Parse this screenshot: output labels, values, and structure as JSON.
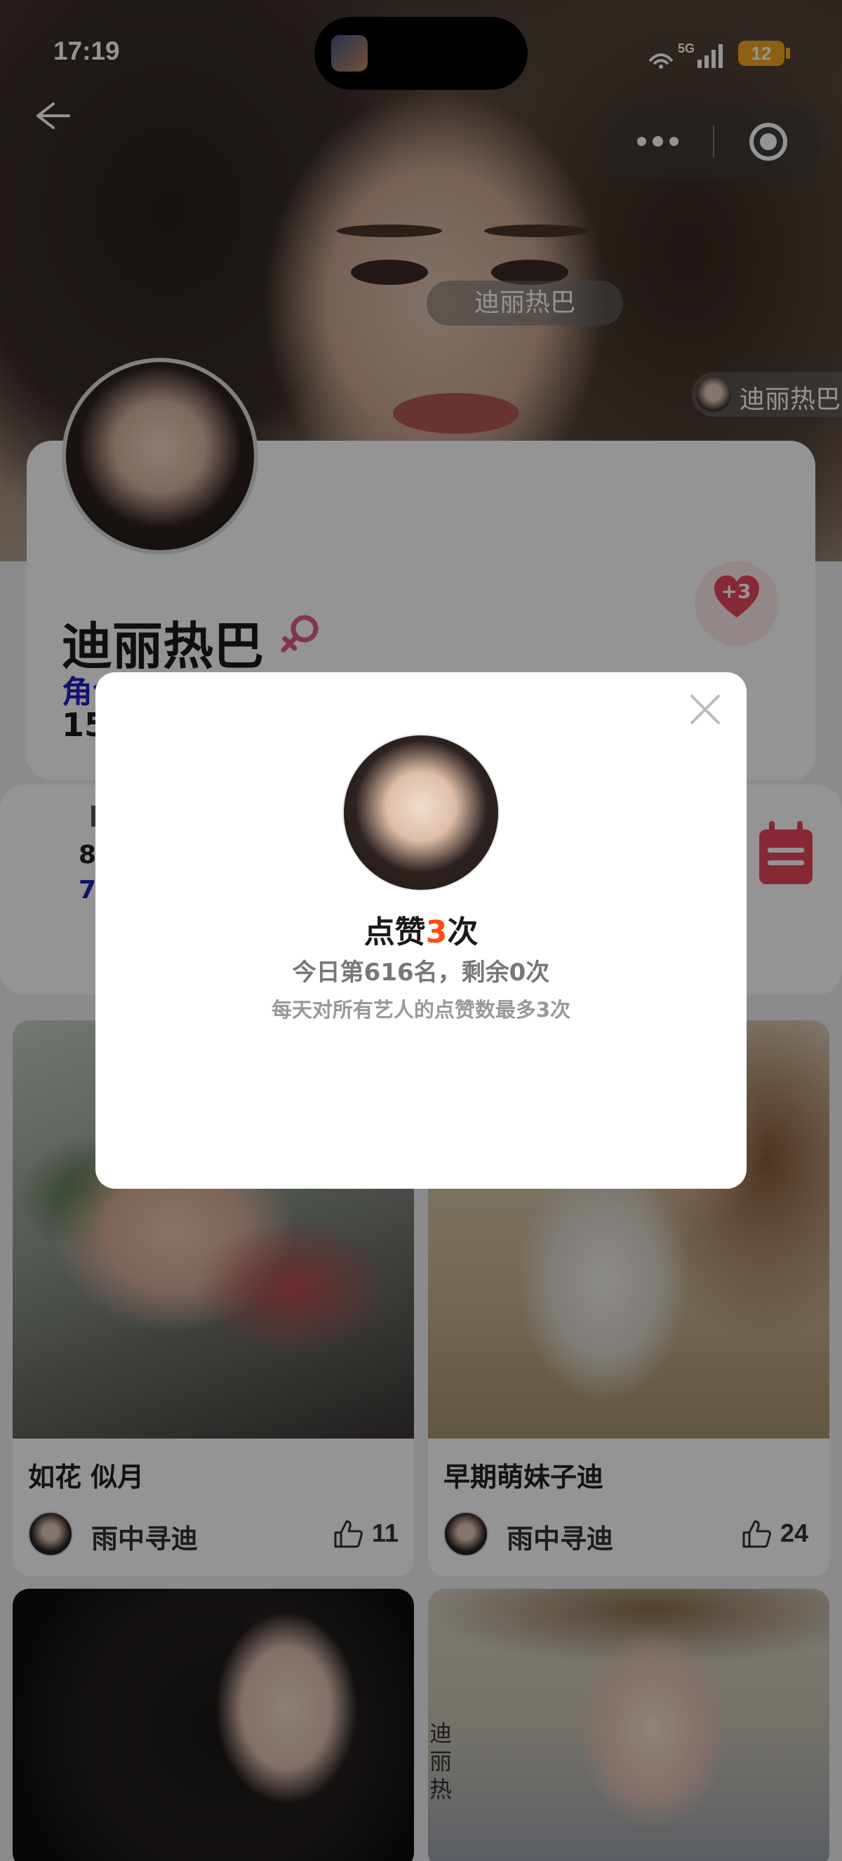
{
  "status_bar": {
    "time": "17:19",
    "network": "5G",
    "battery": "12"
  },
  "hero": {
    "name_chip": "迪丽热巴",
    "side_chip": "迪丽热巴"
  },
  "profile": {
    "name": "迪丽热巴",
    "role_label": "角色/类型",
    "count_label": "15",
    "like_badge": "+3",
    "stat_a": "8",
    "stat_b": "7"
  },
  "feed": [
    {
      "title": "如花 似月",
      "author": "雨中寻迪",
      "likes": "11"
    },
    {
      "title": "早期萌妹子迪",
      "author": "雨中寻迪",
      "likes": "24"
    }
  ],
  "card_stamp": "迪丽热",
  "modal": {
    "title_prefix": "点赞",
    "title_count": "3",
    "title_suffix": "次",
    "rank_text": "今日第616名，剩余0次",
    "note_text": "每天对所有艺人的点赞数最多3次"
  },
  "colors": {
    "accent": "#ff4a12",
    "heart": "#e8455c",
    "role": "#2020c0"
  }
}
